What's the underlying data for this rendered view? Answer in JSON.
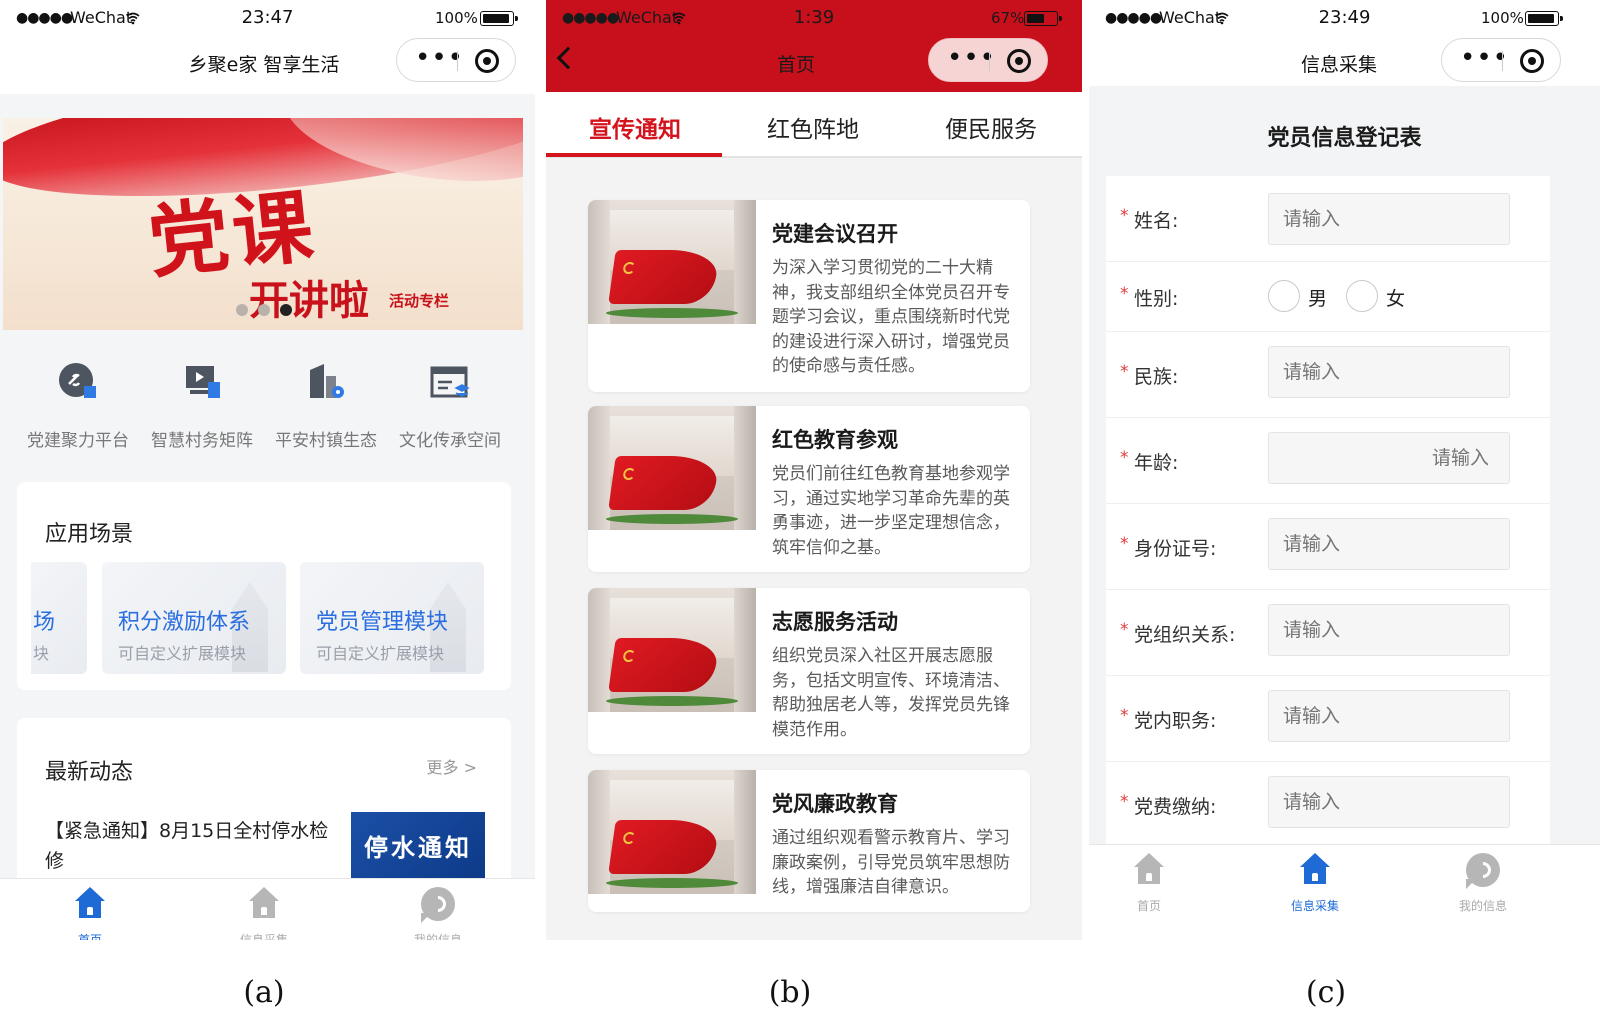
{
  "status_a": {
    "carrier": "WeChat",
    "time": "23:47",
    "battery": "100%"
  },
  "status_b": {
    "carrier": "WeChat",
    "time": "1:39",
    "battery": "67%"
  },
  "status_c": {
    "carrier": "WeChat",
    "time": "23:49",
    "battery": "100%"
  },
  "capsule": {
    "more": "•••"
  },
  "phone_a": {
    "nav_title": "乡聚e家 智享生活",
    "banner": {
      "main": "党课",
      "sub": "开讲啦",
      "tag": "活动专栏",
      "active_slide": 3,
      "slide_count": 3
    },
    "quick_links": [
      {
        "label": "党建聚力平台",
        "icon": "link-cube-icon"
      },
      {
        "label": "智慧村务矩阵",
        "icon": "screen-doc-icon"
      },
      {
        "label": "平安村镇生态",
        "icon": "building-gear-icon"
      },
      {
        "label": "文化传承空间",
        "icon": "window-layers-icon"
      }
    ],
    "scenes": {
      "title": "应用场景",
      "items": [
        {
          "title": "场",
          "subtitle": "块"
        },
        {
          "title": "积分激励体系",
          "subtitle": "可自定义扩展模块"
        },
        {
          "title": "党员管理模块",
          "subtitle": "可自定义扩展模块"
        }
      ]
    },
    "news": {
      "title": "最新动态",
      "more": "更多 >",
      "item_text": "【紧急通知】8月15日全村停水检修",
      "thumb_text": "停水通知"
    },
    "tabbar": [
      {
        "label": "首页",
        "icon": "home-icon",
        "active": true
      },
      {
        "label": "信息采集",
        "icon": "home-icon",
        "active": false
      },
      {
        "label": "我的信息",
        "icon": "chat-icon",
        "active": false
      }
    ]
  },
  "phone_b": {
    "nav_title": "首页",
    "tabs": [
      {
        "label": "宣传通知",
        "active": true
      },
      {
        "label": "红色阵地",
        "active": false
      },
      {
        "label": "便民服务",
        "active": false
      }
    ],
    "cards": [
      {
        "title": "党建会议召开",
        "text": "为深入学习贯彻党的二十大精神，我支部组织全体党员召开专题学习会议，重点围绕新时代党的建设进行深入研讨，增强党员的使命感与责任感。"
      },
      {
        "title": "红色教育参观",
        "text": "党员们前往红色教育基地参观学习，通过实地学习革命先辈的英勇事迹，进一步坚定理想信念，筑牢信仰之基。"
      },
      {
        "title": "志愿服务活动",
        "text": "组织党员深入社区开展志愿服务，包括文明宣传、环境清洁、帮助独居老人等，发挥党员先锋模范作用。"
      },
      {
        "title": "党风廉政教育",
        "text": "通过组织观看警示教育片、学习廉政案例，引导党员筑牢思想防线，增强廉洁自律意识。"
      }
    ]
  },
  "phone_c": {
    "nav_title": "信息采集",
    "form_title": "党员信息登记表",
    "required_mark": "*",
    "fields": [
      {
        "label": "姓名:",
        "type": "input",
        "placeholder": "请输入"
      },
      {
        "label": "性别:",
        "type": "radio",
        "options": [
          "男",
          "女"
        ]
      },
      {
        "label": "民族:",
        "type": "input",
        "placeholder": "请输入"
      },
      {
        "label": "年龄:",
        "type": "input",
        "placeholder": "请输入"
      },
      {
        "label": "身份证号:",
        "type": "input",
        "placeholder": "请输入"
      },
      {
        "label": "党组织关系:",
        "type": "input",
        "placeholder": "请输入"
      },
      {
        "label": "党内职务:",
        "type": "input",
        "placeholder": "请输入"
      },
      {
        "label": "党费缴纳:",
        "type": "input",
        "placeholder": "请输入"
      }
    ],
    "tabbar": [
      {
        "label": "首页",
        "icon": "home-icon",
        "active": false
      },
      {
        "label": "信息采集",
        "icon": "home-icon",
        "active": true
      },
      {
        "label": "我的信息",
        "icon": "chat-icon",
        "active": false
      }
    ]
  },
  "captions": [
    "(a)",
    "(b)",
    "(c)"
  ],
  "colors": {
    "brand_red": "#c8101c",
    "tab_red": "#d4141d",
    "link_blue": "#2a6ee0",
    "tab_blue": "#1e6bd6",
    "required_red": "#e23b3b"
  }
}
